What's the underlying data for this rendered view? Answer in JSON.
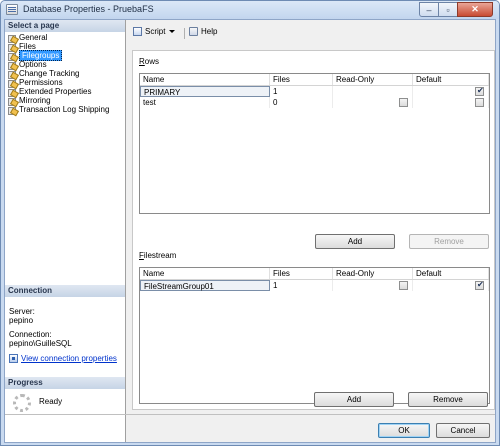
{
  "window": {
    "title": "Database Properties - PruebaFS"
  },
  "left": {
    "select_page_header": "Select a page",
    "pages": [
      {
        "label": "General"
      },
      {
        "label": "Files"
      },
      {
        "label": "Filegroups",
        "selected": true
      },
      {
        "label": "Options"
      },
      {
        "label": "Change Tracking"
      },
      {
        "label": "Permissions"
      },
      {
        "label": "Extended Properties"
      },
      {
        "label": "Mirroring"
      },
      {
        "label": "Transaction Log Shipping"
      }
    ],
    "connection_header": "Connection",
    "server_label": "Server:",
    "server_value": "pepino",
    "connection_label": "Connection:",
    "connection_value": "pepino\\GuilleSQL",
    "view_link": "View connection properties",
    "progress_header": "Progress",
    "progress_status": "Ready"
  },
  "toolbar": {
    "script_label": "Script",
    "help_label": "Help"
  },
  "rows_group": {
    "label_first": "R",
    "label_rest": "ows",
    "columns": [
      "Name",
      "Files",
      "Read-Only",
      "Default"
    ],
    "rows": [
      {
        "name": "PRIMARY",
        "files": "1",
        "read_only": false,
        "read_only_shown": false,
        "default": true
      },
      {
        "name": "test",
        "files": "0",
        "read_only": false,
        "read_only_shown": true,
        "default": false
      }
    ],
    "add_label": "Add",
    "remove_label": "Remove"
  },
  "filestream_group": {
    "label_first": "F",
    "label_rest": "ilestream",
    "columns": [
      "Name",
      "Files",
      "Read-Only",
      "Default"
    ],
    "rows": [
      {
        "name": "FileStreamGroup01",
        "files": "1",
        "read_only": false,
        "default": true
      }
    ],
    "add_label": "Add",
    "remove_label": "Remove"
  },
  "footer": {
    "ok_label": "OK",
    "cancel_label": "Cancel"
  }
}
